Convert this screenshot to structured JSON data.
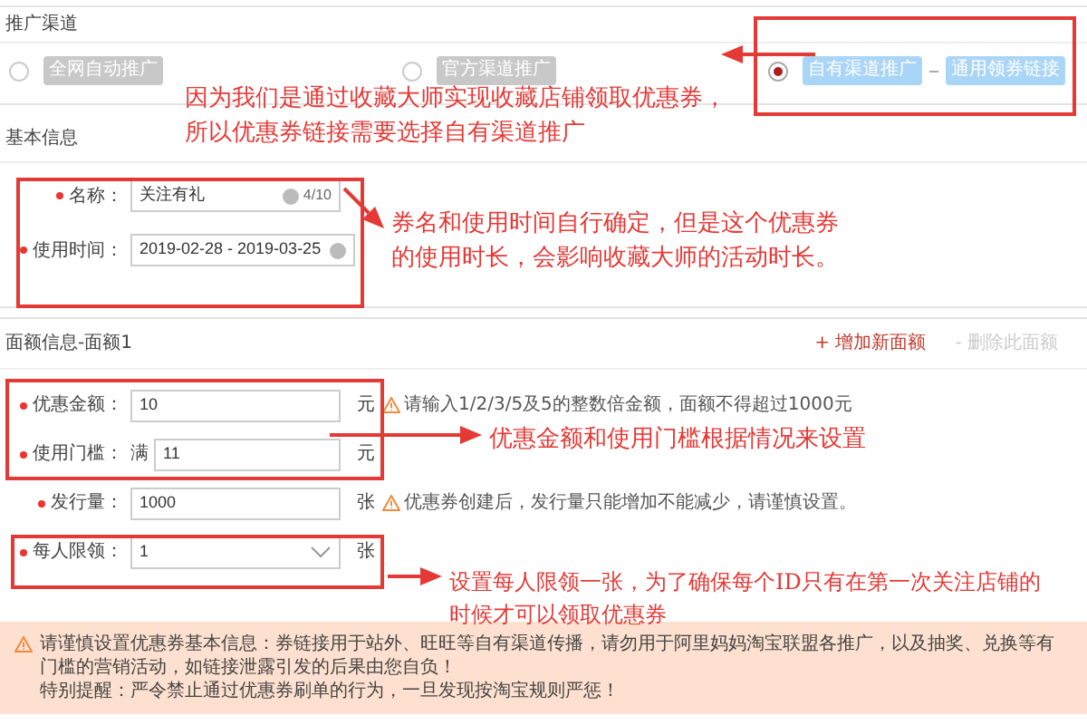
{
  "channel_section": {
    "title": "推广渠道",
    "options": [
      {
        "label": "全网自动推广",
        "selected": false
      },
      {
        "label": "官方渠道推广",
        "selected": false
      },
      {
        "label": "自有渠道推广",
        "selected": true,
        "tag": "通用领券链接"
      }
    ]
  },
  "basic_info": {
    "title": "基本信息",
    "fields": [
      {
        "kind": "text",
        "label": "名称：",
        "required": true,
        "value": "关注有礼",
        "counter": "4/10"
      },
      {
        "kind": "daterange",
        "label": "使用时间：",
        "required": true,
        "start": "2019-02-28",
        "separator": "-",
        "end": "2019-03-25"
      }
    ]
  },
  "denomination": {
    "title": "面额信息-面额1",
    "actions": [
      {
        "label": "+ 增加新面额",
        "disabled": false
      },
      {
        "label": "- 删除此面额",
        "disabled": true
      }
    ],
    "fields": [
      {
        "kind": "text",
        "label": "优惠金额：",
        "required": true,
        "value": "10",
        "unit": "元",
        "hint": "请输入1/2/3/5及5的整数倍金额，面额不得超过1000元"
      },
      {
        "kind": "text",
        "label": "使用门槛：",
        "required": true,
        "prefix": "满",
        "value": "11",
        "unit": "元"
      },
      {
        "kind": "text",
        "label": "发行量：",
        "required": true,
        "value": "1000",
        "unit": "张",
        "hint": "优惠券创建后，发行量只能增加不能减少，请谨慎设置。"
      },
      {
        "kind": "select",
        "label": "每人限领：",
        "required": true,
        "value": "1",
        "unit": "张"
      }
    ]
  },
  "notice": {
    "lines": [
      "请谨慎设置优惠券基本信息：券链接用于站外、旺旺等自有渠道传播，请勿用于阿里妈妈淘宝联盟各推广，以及抽奖、兑换等有门槛的营销活动，如链接泄露引发的后果由您自负！",
      "特别提醒：严令禁止通过优惠券刷单的行为，一旦发现按淘宝规则严惩！"
    ]
  },
  "annotations": [
    {
      "lines": [
        "因为我们是通过收藏大师实现收藏店铺领取优惠券，",
        "所以优惠券链接需要选择自有渠道推广"
      ]
    },
    {
      "lines": [
        "券名和使用时间自行确定，但是这个优惠券",
        "的使用时长，会影响收藏大师的活动时长。"
      ]
    },
    {
      "lines": [
        "优惠金额和使用门槛根据情况来设置"
      ]
    },
    {
      "lines": [
        "设置每人限领一张，为了确保每个ID只有在第一次关注店铺的",
        "时候才可以领取优惠券"
      ]
    }
  ]
}
